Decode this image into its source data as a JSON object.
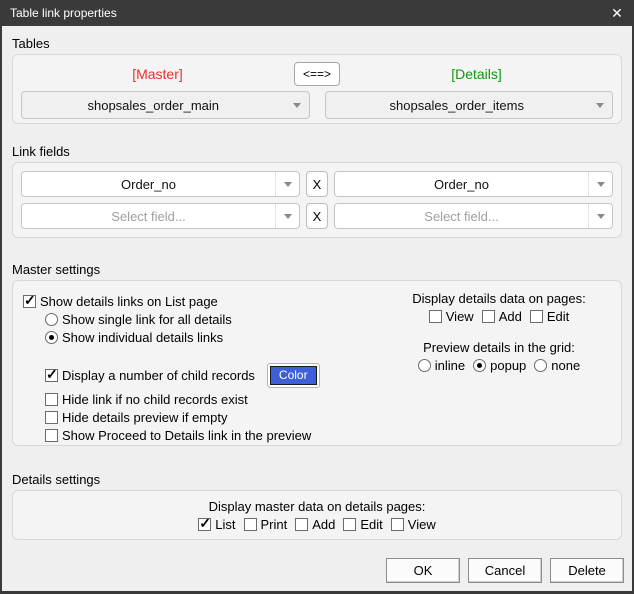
{
  "dialog": {
    "title": "Table link properties",
    "close_glyph": "✕"
  },
  "tables": {
    "label": "Tables",
    "master_tag": "[Master]",
    "link_button": "<==>",
    "details_tag": "[Details]",
    "master_table": "shopsales_order_main",
    "details_table": "shopsales_order_items"
  },
  "link_fields": {
    "label": "Link fields",
    "remove_label": "X",
    "rows": [
      {
        "master": "Order_no",
        "details": "Order_no",
        "placeholder": false
      },
      {
        "master": "Select field...",
        "details": "Select field...",
        "placeholder": true
      }
    ]
  },
  "master_settings": {
    "label": "Master settings",
    "show_details_links": {
      "label": "Show details links on List page",
      "checked": true
    },
    "single_link": {
      "label": "Show single link for all details",
      "selected": false
    },
    "individual_links": {
      "label": "Show individual details links",
      "selected": true
    },
    "display_child_count": {
      "label": "Display a number of child records",
      "checked": true
    },
    "color_button": "Color",
    "hide_link": {
      "label": "Hide link if no child records exist",
      "checked": false
    },
    "hide_preview": {
      "label": "Hide details preview if empty",
      "checked": false
    },
    "show_proceed": {
      "label": "Show Proceed to Details link in the preview",
      "checked": false
    },
    "display_details_data": {
      "label": "Display details data on pages:",
      "options": [
        {
          "label": "View",
          "checked": false
        },
        {
          "label": "Add",
          "checked": false
        },
        {
          "label": "Edit",
          "checked": false
        }
      ]
    },
    "preview_grid": {
      "label": "Preview details in the grid:",
      "options": [
        {
          "label": "inline",
          "selected": false
        },
        {
          "label": "popup",
          "selected": true
        },
        {
          "label": "none",
          "selected": false
        }
      ]
    }
  },
  "details_settings": {
    "label": "Details settings",
    "display_master_data": {
      "label": "Display master data on details pages:",
      "options": [
        {
          "label": "List",
          "checked": true
        },
        {
          "label": "Print",
          "checked": false
        },
        {
          "label": "Add",
          "checked": false
        },
        {
          "label": "Edit",
          "checked": false
        },
        {
          "label": "View",
          "checked": false
        }
      ]
    }
  },
  "footer": {
    "ok": "OK",
    "cancel": "Cancel",
    "delete": "Delete"
  },
  "colors": {
    "titlebar": "#3a3a3a",
    "dialog_bg": "#efefef",
    "master_red": "#ee2d2d",
    "details_green": "#149614",
    "swatch_blue": "#3d5fd8"
  }
}
